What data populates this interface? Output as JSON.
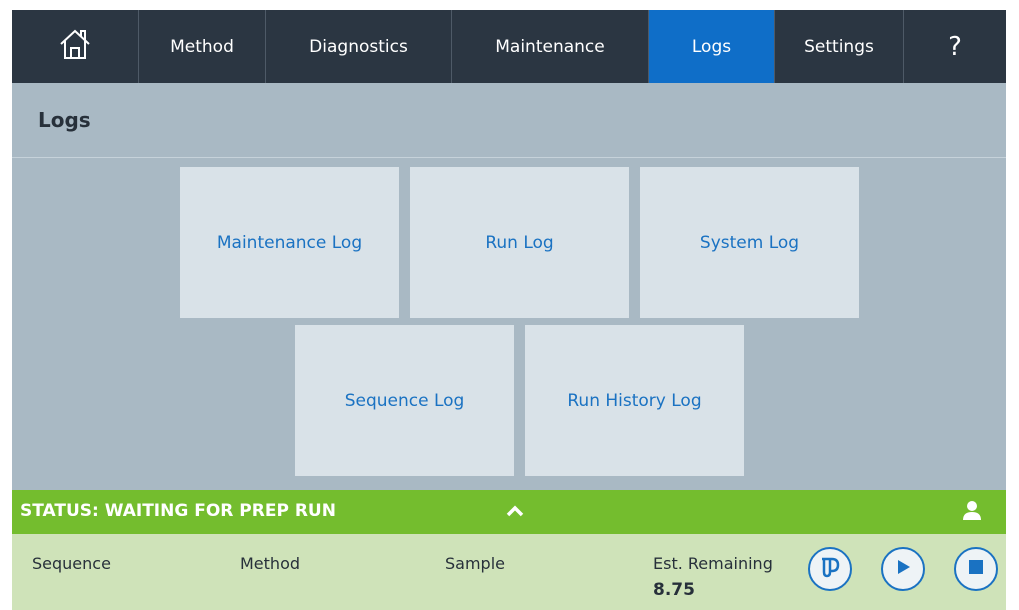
{
  "nav": {
    "home_icon": "home-icon",
    "items": [
      {
        "label": "Method"
      },
      {
        "label": "Diagnostics"
      },
      {
        "label": "Maintenance"
      },
      {
        "label": "Logs"
      },
      {
        "label": "Settings"
      }
    ],
    "help_label": "?",
    "active": "Logs"
  },
  "page": {
    "title": "Logs",
    "tiles": [
      {
        "label": "Maintenance Log"
      },
      {
        "label": "Run Log"
      },
      {
        "label": "System Log"
      },
      {
        "label": "Sequence Log"
      },
      {
        "label": "Run History Log"
      }
    ]
  },
  "status": {
    "text": "STATUS: WAITING FOR PREP RUN",
    "chevron_icon": "chevron-up-icon",
    "user_icon": "user-icon"
  },
  "info": {
    "sequence_label": "Sequence",
    "method_label": "Method",
    "sample_label": "Sample",
    "remaining_label": "Est. Remaining",
    "remaining_value": "8.75"
  },
  "colors": {
    "nav_bg": "#2b3642",
    "nav_active": "#0f6ec8",
    "page_bg": "#a9b9c4",
    "tile_bg": "#d9e2e8",
    "link_blue": "#1a72c2",
    "status_green": "#74bd2e",
    "info_bg": "#cfe3b9"
  }
}
